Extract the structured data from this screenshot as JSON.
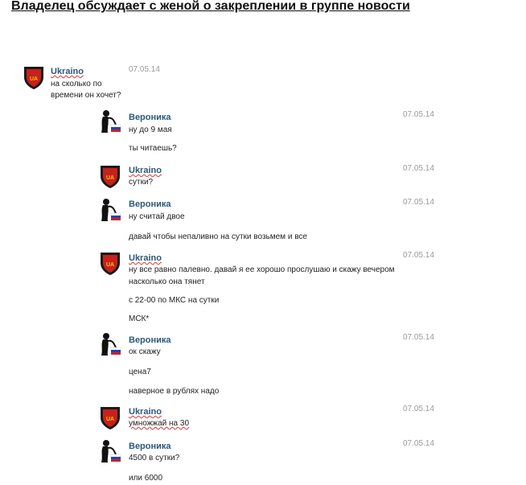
{
  "title": "Владелец обсуждает с женой о закреплении в группе новости",
  "messages": [
    {
      "author": "Ukraino",
      "avatar": "ua-shield-icon",
      "date": "07.05.14",
      "lines": [
        "на сколько по",
        "времени он хочет?"
      ]
    },
    {
      "author": "Вероника",
      "avatar": "woman-silhouette-icon",
      "date": "07.05.14",
      "lines": [
        "ну до 9 мая",
        "ты читаешь?"
      ]
    },
    {
      "author": "Ukraino",
      "avatar": "ua-shield-icon",
      "date": "07.05.14",
      "lines": [
        "сутки?"
      ]
    },
    {
      "author": "Вероника",
      "avatar": "woman-silhouette-icon",
      "date": "07.05.14",
      "lines": [
        "ну считай двое",
        "давай чтобы непаливно на сутки возьмем и все"
      ]
    },
    {
      "author": "Ukraino",
      "avatar": "ua-shield-icon",
      "date": "07.05.14",
      "lines": [
        "ну все равно палевно. давай я ее хорошо прослушаю и скажу вечером",
        "насколько она тянет",
        "с 22-00 по МКС на сутки",
        "МСК*"
      ]
    },
    {
      "author": "Вероника",
      "avatar": "woman-silhouette-icon",
      "date": "07.05.14",
      "lines": [
        "ок скажу",
        "цена7",
        "наверное в рублях надо"
      ]
    },
    {
      "author": "Ukraino",
      "avatar": "ua-shield-icon",
      "date": "07.05.14",
      "lines": [
        "умножжай на 30"
      ]
    },
    {
      "author": "Вероника",
      "avatar": "woman-silhouette-icon",
      "date": "07.05.14",
      "lines": [
        "4500 в сутки?",
        "или 6000"
      ]
    }
  ]
}
